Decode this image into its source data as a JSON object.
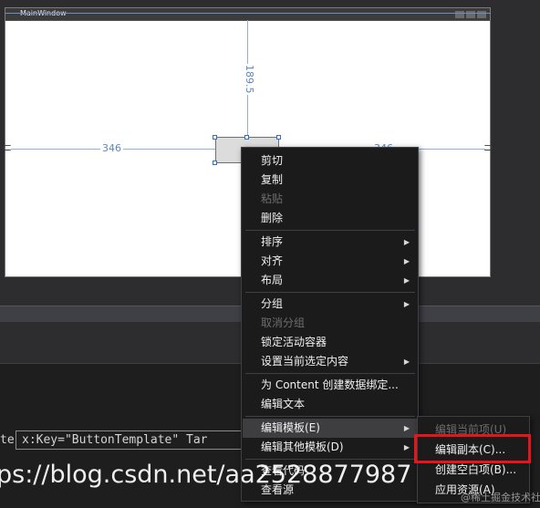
{
  "designer": {
    "window_title": "MainWindow",
    "margin_top": "189.5",
    "margin_left": "346",
    "margin_right": "346"
  },
  "xaml": {
    "prefix_text": "te",
    "key_line": "x:Key=\"ButtonTemplate\" Tar"
  },
  "context_menu": {
    "items": [
      {
        "label": "剪切",
        "disabled": false,
        "submenu": false
      },
      {
        "label": "复制",
        "disabled": false,
        "submenu": false
      },
      {
        "label": "粘贴",
        "disabled": true,
        "submenu": false
      },
      {
        "label": "删除",
        "disabled": false,
        "submenu": false
      },
      {
        "label": "排序",
        "disabled": false,
        "submenu": true
      },
      {
        "label": "对齐",
        "disabled": false,
        "submenu": true
      },
      {
        "label": "布局",
        "disabled": false,
        "submenu": true
      },
      {
        "label": "分组",
        "disabled": false,
        "submenu": true
      },
      {
        "label": "取消分组",
        "disabled": true,
        "submenu": false
      },
      {
        "label": "锁定活动容器",
        "disabled": false,
        "submenu": false
      },
      {
        "label": "设置当前选定内容",
        "disabled": false,
        "submenu": true
      },
      {
        "label": "为 Content 创建数据绑定...",
        "disabled": false,
        "submenu": false
      },
      {
        "label": "编辑文本",
        "disabled": false,
        "submenu": false
      },
      {
        "label": "编辑模板(E)",
        "disabled": false,
        "submenu": true,
        "highlighted": true
      },
      {
        "label": "编辑其他模板(D)",
        "disabled": false,
        "submenu": true
      },
      {
        "label": "查看代码",
        "disabled": false,
        "submenu": false
      },
      {
        "label": "查看源",
        "disabled": false,
        "submenu": false
      }
    ],
    "submenu_arrow": "▶"
  },
  "submenu": {
    "items": [
      {
        "label": "编辑当前项(U)",
        "disabled": true
      },
      {
        "label": "编辑副本(C)...",
        "disabled": false
      },
      {
        "label": "创建空白项(B)...",
        "disabled": false
      },
      {
        "label": "应用资源(A)",
        "disabled": false
      }
    ]
  },
  "watermark": {
    "main": "ps://blog.csdn.net/aa2528877987",
    "small": "@稀土掘金技术社区"
  },
  "icons": {
    "anchor": "anchor-icon",
    "arrow": "chevron-right-icon"
  },
  "colors": {
    "accent": "#5d86c2",
    "highlight_box": "#e8141b",
    "menu_bg": "#1b1b1c"
  }
}
